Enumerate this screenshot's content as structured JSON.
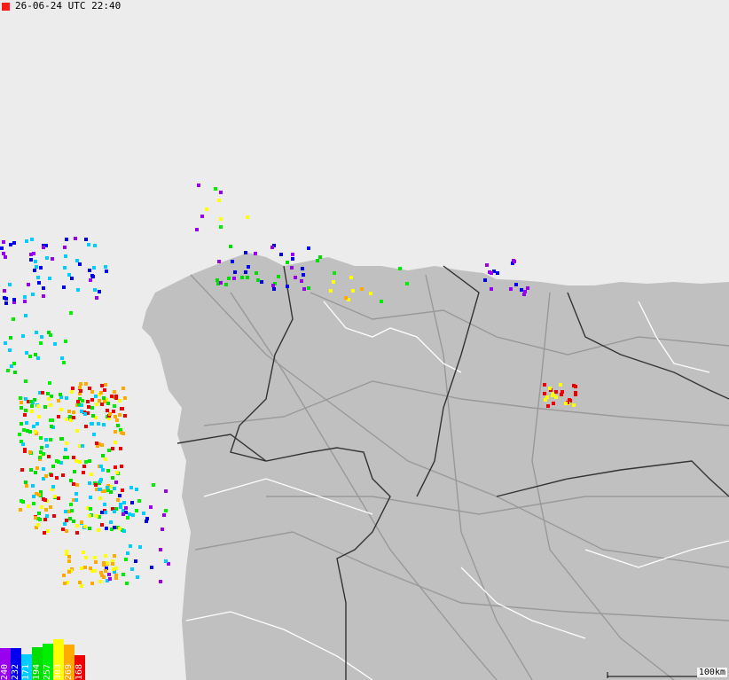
{
  "timestamp": {
    "indicator_color": "#ff1a1a",
    "text": "26-06-24 UTC 22:40"
  },
  "legend": {
    "bars": [
      {
        "count": "240",
        "color": "#9900ee",
        "level": 0.78
      },
      {
        "count": "232",
        "color": "#0000ee",
        "level": 0.78
      },
      {
        "count": "171",
        "color": "#00ccff",
        "level": 0.62
      },
      {
        "count": "194",
        "color": "#00dd00",
        "level": 0.8
      },
      {
        "count": "257",
        "color": "#00ee00",
        "level": 0.9
      },
      {
        "count": "303",
        "color": "#ffff00",
        "level": 1.0
      },
      {
        "count": "269",
        "color": "#ffaa00",
        "level": 0.88
      },
      {
        "count": "168",
        "color": "#ee0000",
        "level": 0.6
      }
    ]
  },
  "scale": {
    "label": "100km"
  },
  "colors": {
    "sea": "#ececec",
    "land": "#c0c0c0",
    "roads": "#9a9a9a",
    "borders": "#333333",
    "rivers": "#ffffff"
  }
}
